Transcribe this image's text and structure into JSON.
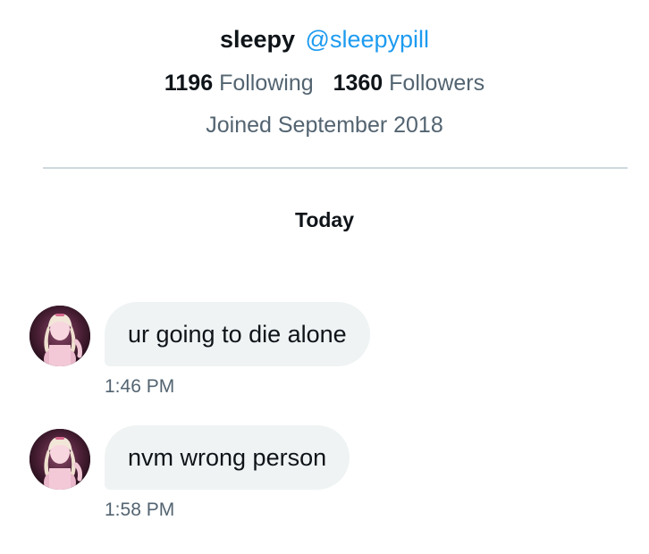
{
  "profile": {
    "display_name": "sleepy",
    "handle": "@sleepypill",
    "following_count": "1196",
    "following_label": "Following",
    "followers_count": "1360",
    "followers_label": "Followers",
    "joined": "Joined September 2018"
  },
  "date_separator": "Today",
  "messages": [
    {
      "text": "ur going to die alone",
      "time": "1:46 PM"
    },
    {
      "text": "nvm wrong person",
      "time": "1:58 PM"
    }
  ],
  "colors": {
    "handle": "#1d9bf0",
    "primary_text": "#0f1419",
    "secondary_text": "#536471",
    "bubble_background": "#eff3f4",
    "divider": "#cfd9de"
  }
}
